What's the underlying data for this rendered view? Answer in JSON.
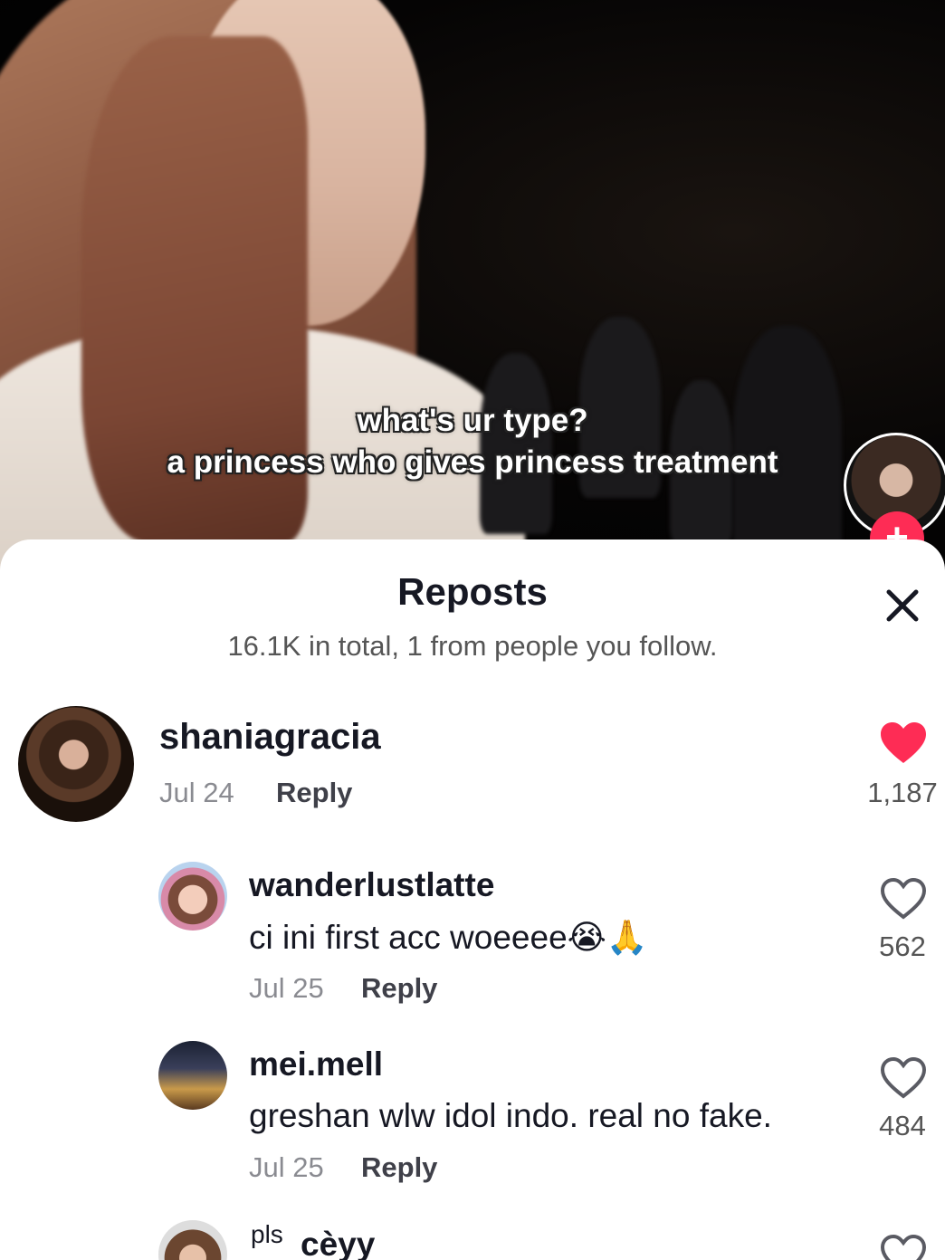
{
  "video": {
    "caption_line1": "what's ur type?",
    "caption_line2": "a princess who gives princess treatment",
    "follow_plus": "+"
  },
  "sheet": {
    "title": "Reposts",
    "subtitle": "16.1K in total, 1 from people you follow.",
    "close_icon": "close-icon"
  },
  "comments": [
    {
      "username": "shaniagracia",
      "date": "Jul 24",
      "reply_label": "Reply",
      "likes": "1,187",
      "liked": true
    },
    {
      "username": "wanderlustlatte",
      "text": "ci ini first acc woeeee😭🙏",
      "date": "Jul 25",
      "reply_label": "Reply",
      "likes": "562",
      "liked": false
    },
    {
      "username": "mei.mell",
      "text": "greshan wlw idol indo. real no fake.",
      "date": "Jul 25",
      "reply_label": "Reply",
      "likes": "484",
      "liked": false
    },
    {
      "prefix": "pls",
      "username": "cèyy",
      "liked": false
    }
  ],
  "colors": {
    "accent": "#fe2c55",
    "text": "#161823",
    "muted": "#8a8b91"
  }
}
